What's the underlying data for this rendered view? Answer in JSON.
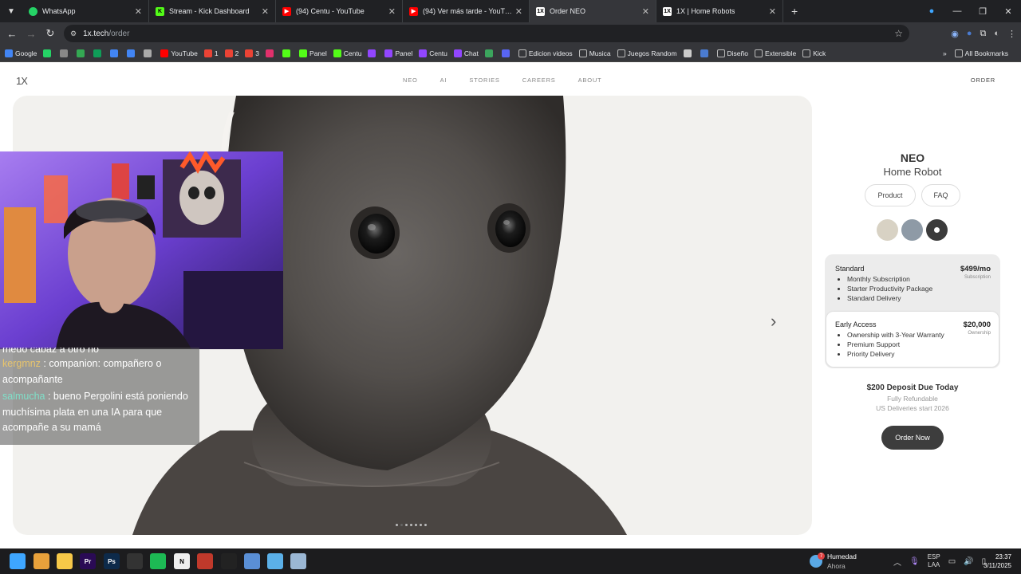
{
  "browser": {
    "tabs": [
      {
        "title": "WhatsApp",
        "icon": "whatsapp-icon",
        "color": "#25d366"
      },
      {
        "title": "Stream - Kick Dashboard",
        "icon": "kick-icon",
        "color": "#53fc18"
      },
      {
        "title": "(94) Centu - YouTube",
        "icon": "youtube-icon",
        "color": "#ff0000"
      },
      {
        "title": "(94) Ver más tarde - YouTube",
        "icon": "youtube-icon",
        "color": "#ff0000"
      },
      {
        "title": "Order NEO",
        "icon": "1x-icon",
        "color": "#ffffff"
      },
      {
        "title": "1X | Home Robots",
        "icon": "1x-icon",
        "color": "#ffffff"
      }
    ],
    "active_tab": 4,
    "new_tab": "+",
    "url_host": "1x.tech",
    "url_path": "/order",
    "bookmarks": [
      {
        "label": "Google",
        "icon": "google-icon",
        "color": "#4285f4"
      },
      {
        "label": "",
        "icon": "whatsapp-icon",
        "color": "#25d366"
      },
      {
        "label": "",
        "icon": "apple-icon",
        "color": "#888888"
      },
      {
        "label": "",
        "icon": "drive-icon",
        "color": "#34a853"
      },
      {
        "label": "",
        "icon": "sheets-icon",
        "color": "#0f9d58"
      },
      {
        "label": "",
        "icon": "docs-icon",
        "color": "#4285f4"
      },
      {
        "label": "",
        "icon": "translate-icon",
        "color": "#4285f4"
      },
      {
        "label": "",
        "icon": "chatgpt-icon",
        "color": "#aaaaaa"
      },
      {
        "label": "YouTube",
        "icon": "youtube-icon",
        "color": "#ff0000"
      },
      {
        "label": "1",
        "icon": "gmail-icon",
        "color": "#ea4335"
      },
      {
        "label": "2",
        "icon": "gmail-icon",
        "color": "#ea4335"
      },
      {
        "label": "3",
        "icon": "gmail-icon",
        "color": "#ea4335"
      },
      {
        "label": "",
        "icon": "instagram-icon",
        "color": "#e1306c"
      },
      {
        "label": "",
        "icon": "kick-icon",
        "color": "#53fc18"
      },
      {
        "label": "Panel",
        "icon": "kick-icon",
        "color": "#53fc18"
      },
      {
        "label": "Centu",
        "icon": "kick-icon",
        "color": "#53fc18"
      },
      {
        "label": "",
        "icon": "twitch-icon",
        "color": "#9146ff"
      },
      {
        "label": "Panel",
        "icon": "twitch-icon",
        "color": "#9146ff"
      },
      {
        "label": "Centu",
        "icon": "twitch-icon",
        "color": "#9146ff"
      },
      {
        "label": "Chat",
        "icon": "twitch-icon",
        "color": "#9146ff"
      },
      {
        "label": "",
        "icon": "extension-icon",
        "color": "#3ba55d"
      },
      {
        "label": "",
        "icon": "discord-icon",
        "color": "#5865f2"
      },
      {
        "label": "Edicion videos",
        "icon": "folder-icon",
        "color": "#bbbbbb"
      },
      {
        "label": "Musica",
        "icon": "folder-icon",
        "color": "#bbbbbb"
      },
      {
        "label": "Juegos Random",
        "icon": "folder-icon",
        "color": "#bbbbbb"
      },
      {
        "label": "",
        "icon": "cat-icon",
        "color": "#cccccc"
      },
      {
        "label": "",
        "icon": "extension-icon",
        "color": "#4a7bd0"
      },
      {
        "label": "Diseño",
        "icon": "folder-icon",
        "color": "#bbbbbb"
      },
      {
        "label": "Extensible",
        "icon": "folder-icon",
        "color": "#bbbbbb"
      },
      {
        "label": "Kick",
        "icon": "folder-icon",
        "color": "#bbbbbb"
      }
    ],
    "bookmarks_more": "»",
    "all_bookmarks": "All Bookmarks"
  },
  "site": {
    "logo": "1X",
    "nav": [
      "NEO",
      "AI",
      "STORIES",
      "CAREERS",
      "ABOUT"
    ],
    "order_link": "ORDER"
  },
  "carousel": {
    "slide_count": 7,
    "active_slide": 1
  },
  "product": {
    "name": "NEO",
    "subtitle": "Home Robot",
    "tabs": [
      "Product",
      "FAQ"
    ],
    "colors": [
      {
        "name": "tan",
        "hex": "#d8d2c4"
      },
      {
        "name": "gray-blue",
        "hex": "#8e9aa6"
      },
      {
        "name": "dark",
        "hex": "#3b3b3b"
      }
    ],
    "selected_color": 2,
    "plans": [
      {
        "name": "Standard",
        "price": "$499/mo",
        "note": "Subscription",
        "features": [
          "Monthly Subscription",
          "Starter Productivity Package",
          "Standard Delivery"
        ]
      },
      {
        "name": "Early Access",
        "price": "$20,000",
        "note": "Ownership",
        "features": [
          "Ownership with 3-Year Warranty",
          "Premium Support",
          "Priority Delivery"
        ]
      }
    ],
    "selected_plan": 1,
    "deposit": "$200 Deposit Due Today",
    "refund": "Fully Refundable",
    "delivery": "US Deliveries start 2026",
    "order_button": "Order Now"
  },
  "chat": {
    "partial_line": "medo capaz a otro no",
    "messages": [
      {
        "user": "kergmnz",
        "text": " : companion: compañero o acompañante"
      },
      {
        "user": "salmucha",
        "text": " : bueno Pergolini está poniendo muchísima plata en una IA para que acompañe a su mamá"
      }
    ]
  },
  "taskbar": {
    "apps": [
      {
        "icon": "windows-start-icon",
        "color": "#3ea6ff",
        "label": ""
      },
      {
        "icon": "chrome-icon",
        "color": "#e8a13b",
        "label": ""
      },
      {
        "icon": "file-explorer-icon",
        "color": "#f7c948",
        "label": ""
      },
      {
        "icon": "premiere-icon",
        "color": "#2a0a55",
        "label": "Pr"
      },
      {
        "icon": "photoshop-icon",
        "color": "#0d2a4a",
        "label": "Ps"
      },
      {
        "icon": "obs-icon",
        "color": "#333333",
        "label": ""
      },
      {
        "icon": "spotify-icon",
        "color": "#1db954",
        "label": ""
      },
      {
        "icon": "notion-icon",
        "color": "#eeeeee",
        "label": "N"
      },
      {
        "icon": "stream-app-icon",
        "color": "#c0392b",
        "label": ""
      },
      {
        "icon": "capcut-icon",
        "color": "#222222",
        "label": ""
      },
      {
        "icon": "vs-icon",
        "color": "#5a8fd6",
        "label": ""
      },
      {
        "icon": "notepad-icon",
        "color": "#5bb0e8",
        "label": ""
      },
      {
        "icon": "calculator-icon",
        "color": "#9bb7d4",
        "label": ""
      }
    ],
    "weather_badge": "7",
    "weather_title": "Humedad",
    "weather_sub": "Ahora",
    "lang_top": "ESP",
    "lang_bottom": "LAA",
    "time": "23:37",
    "date": "3/11/2025"
  }
}
